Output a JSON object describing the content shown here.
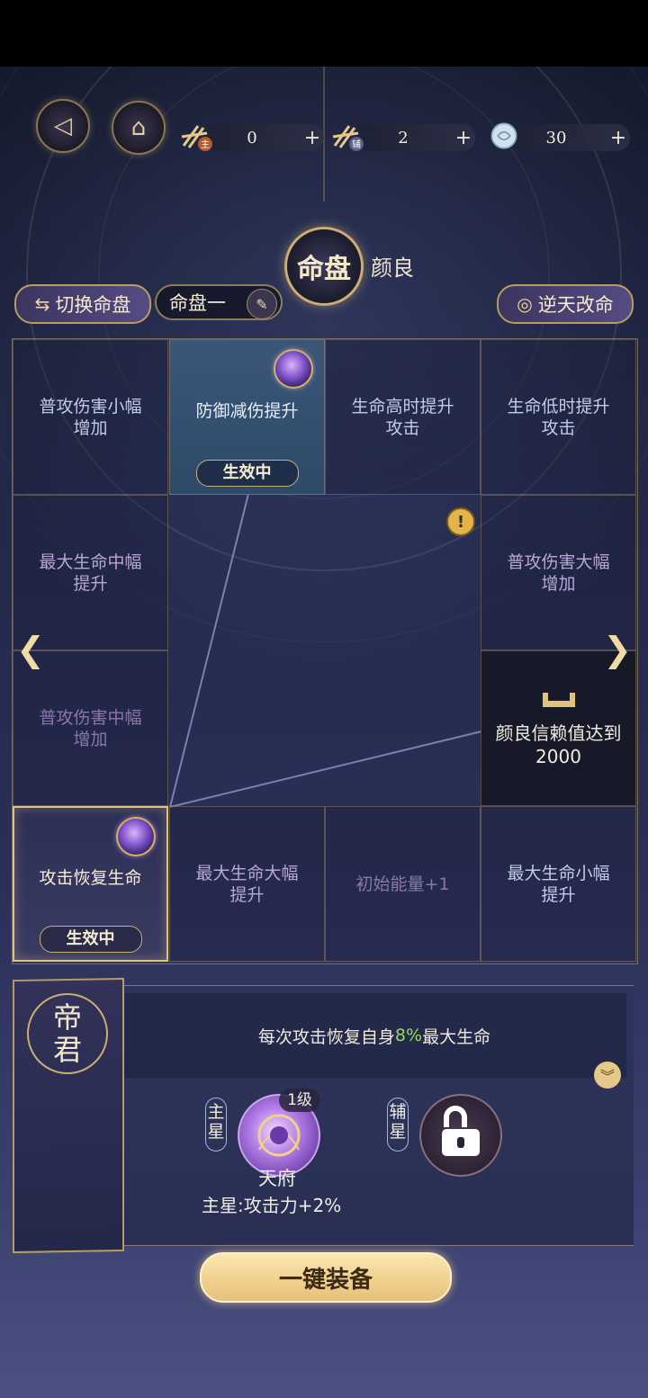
{
  "top": {
    "main_resource": {
      "value": "0",
      "plus": "+",
      "icon_label": "主"
    },
    "aux_resource": {
      "value": "2",
      "plus": "+",
      "icon_label": "辅"
    },
    "coin_resource": {
      "value": "30",
      "plus": "+"
    }
  },
  "header": {
    "title": "命盘",
    "character_name": "颜良",
    "switch_label": "切换命盘",
    "current_pan": "命盘一",
    "nitian_label": "逆天改命"
  },
  "grid": {
    "r0c0": "普攻伤害小幅\n增加",
    "r0c1": "防御减伤提升",
    "r0c1_badge": "生效中",
    "r0c2": "生命高时提升\n攻击",
    "r0c3": "生命低时提升\n攻击",
    "r1c0": "最大生命中幅\n提升",
    "r1c3": "普攻伤害大幅\n增加",
    "r2c0": "普攻伤害中幅\n增加",
    "r2c3_lock": "颜良信赖值达到\n2000",
    "r3c0": "攻击恢复生命",
    "r3c0_badge": "生效中",
    "r3c1": "最大生命大幅\n提升",
    "r3c2": "初始能量+1",
    "r3c3": "最大生命小幅\n提升"
  },
  "info": {
    "emperor_char1": "帝",
    "emperor_char2": "君",
    "desc_prefix": "每次攻击恢复自身",
    "desc_highlight": "8%",
    "desc_suffix": "最大生命",
    "main_star_label": "主星",
    "aux_star_label": "辅星",
    "level": "1级",
    "star_name": "天府",
    "star_effect": "主星:攻击力+2%"
  },
  "equip_label": "一键装备",
  "colors": {
    "gold": "#e0c27a",
    "highlight_green": "#9bd86a",
    "active_blue": "#3b5677"
  }
}
